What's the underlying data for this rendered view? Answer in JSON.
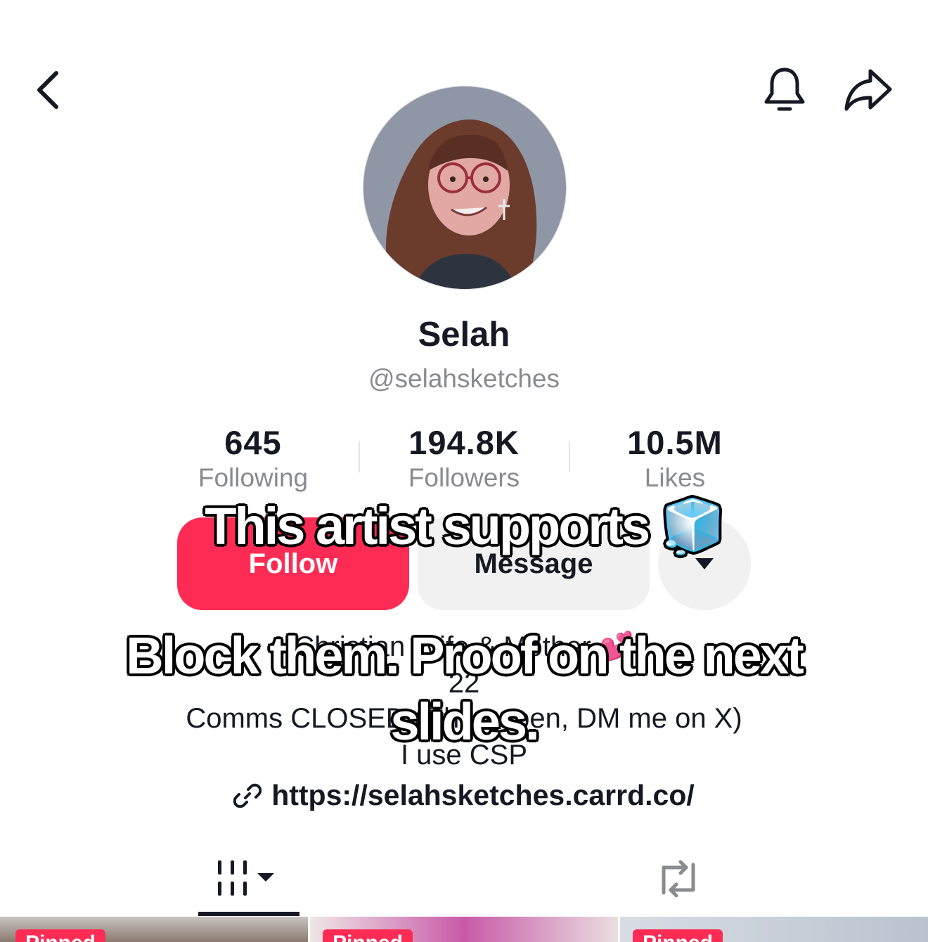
{
  "profile": {
    "display_name": "Selah",
    "handle": "@selahsketches"
  },
  "stats": {
    "following": {
      "value": "645",
      "label": "Following"
    },
    "followers": {
      "value": "194.8K",
      "label": "Followers"
    },
    "likes": {
      "value": "10.5M",
      "label": "Likes"
    }
  },
  "actions": {
    "follow_label": "Follow",
    "message_label": "Message"
  },
  "bio": {
    "line1": "Christian Wife & Mother 💕",
    "line2": "22",
    "line3": "Comms CLOSED (when open, DM me on X)",
    "line4": "I use CSP",
    "link": "https://selahsketches.carrd.co/"
  },
  "overlay": {
    "line1": "This artist supports 🧊",
    "line2": "Block them. Proof on the next",
    "line3": "slides."
  },
  "tabs": {
    "videos": "videos-grid",
    "reposts": "reposts"
  },
  "thumbnails": [
    {
      "badge": "Pinned"
    },
    {
      "badge": "Pinned"
    },
    {
      "badge": "Pinned"
    }
  ],
  "colors": {
    "accent": "#fe2c55",
    "secondary_button": "#f1f1f2",
    "muted_text": "#8a8b91",
    "text": "#161823"
  }
}
